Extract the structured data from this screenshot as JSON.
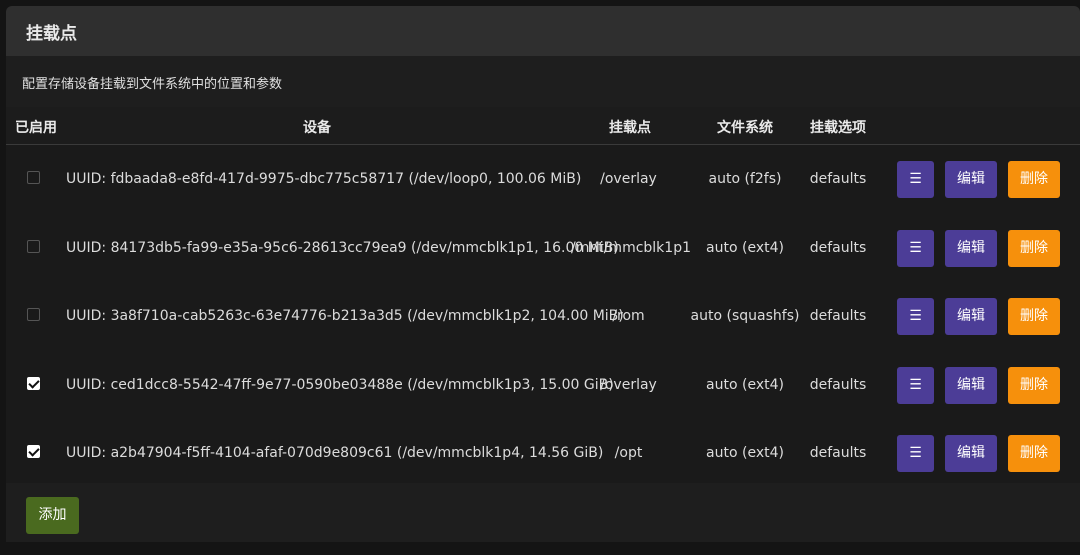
{
  "header": {
    "title": "挂载点"
  },
  "description": "配置存储设备挂载到文件系统中的位置和参数",
  "columns": {
    "enabled": "已启用",
    "device": "设备",
    "mountpoint": "挂载点",
    "filesystem": "文件系统",
    "options": "挂载选项"
  },
  "rows": [
    {
      "enabled": false,
      "device": "UUID: fdbaada8-e8fd-417d-9975-dbc775c58717 (/dev/loop0, 100.06 MiB)",
      "mountpoint": "/overlay",
      "filesystem": "auto (f2fs)",
      "options": "defaults",
      "menu_label": "☰",
      "edit_label": "编辑",
      "delete_label": "删除"
    },
    {
      "enabled": false,
      "device": "UUID: 84173db5-fa99-e35a-95c6-28613cc79ea9 (/dev/mmcblk1p1, 16.00 MiB)",
      "mountpoint": "/mnt/mmcblk1p1",
      "filesystem": "auto (ext4)",
      "options": "defaults",
      "menu_label": "☰",
      "edit_label": "编辑",
      "delete_label": "删除"
    },
    {
      "enabled": false,
      "device": "UUID: 3a8f710a-cab5263c-63e74776-b213a3d5 (/dev/mmcblk1p2, 104.00 MiB)",
      "mountpoint": "/rom",
      "filesystem": "auto (squashfs)",
      "options": "defaults",
      "menu_label": "☰",
      "edit_label": "编辑",
      "delete_label": "删除"
    },
    {
      "enabled": true,
      "device": "UUID: ced1dcc8-5542-47ff-9e77-0590be03488e (/dev/mmcblk1p3, 15.00 GiB)",
      "mountpoint": "/overlay",
      "filesystem": "auto (ext4)",
      "options": "defaults",
      "menu_label": "☰",
      "edit_label": "编辑",
      "delete_label": "删除"
    },
    {
      "enabled": true,
      "device": "UUID: a2b47904-f5ff-4104-afaf-070d9e809c61 (/dev/mmcblk1p4, 14.56 GiB)",
      "mountpoint": "/opt",
      "filesystem": "auto (ext4)",
      "options": "defaults",
      "menu_label": "☰",
      "edit_label": "编辑",
      "delete_label": "删除"
    }
  ],
  "add_label": "添加",
  "colors": {
    "primary": "#4c3d97",
    "danger": "#f6900c",
    "add": "#4a6a1f"
  }
}
